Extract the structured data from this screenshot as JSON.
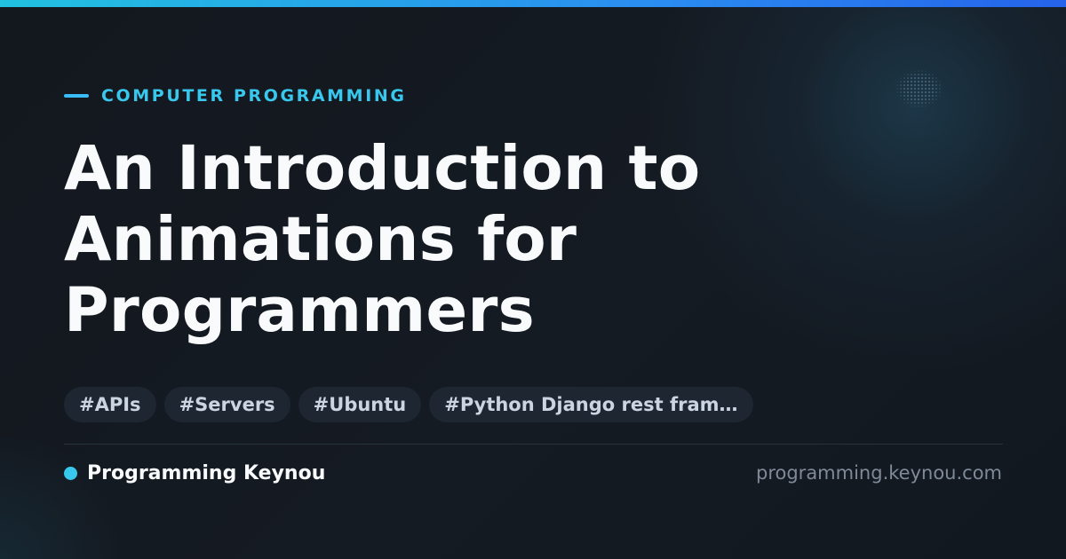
{
  "category": "COMPUTER PROGRAMMING",
  "title_lines": [
    "An Introduction to",
    "Animations for",
    "Programmers"
  ],
  "tags": [
    "#APIs",
    "#Servers",
    "#Ubuntu",
    "#Python Django rest fram…"
  ],
  "brand_name": "Programming Keynou",
  "site_url": "programming.keynou.com",
  "colors": {
    "accent": "#38c8ee",
    "top_bar_start": "#22c1e0",
    "top_bar_end": "#2563eb",
    "background": "#13171e",
    "title": "#f8fafc",
    "tag_background": "#1d2631",
    "url": "#7f8a99"
  }
}
